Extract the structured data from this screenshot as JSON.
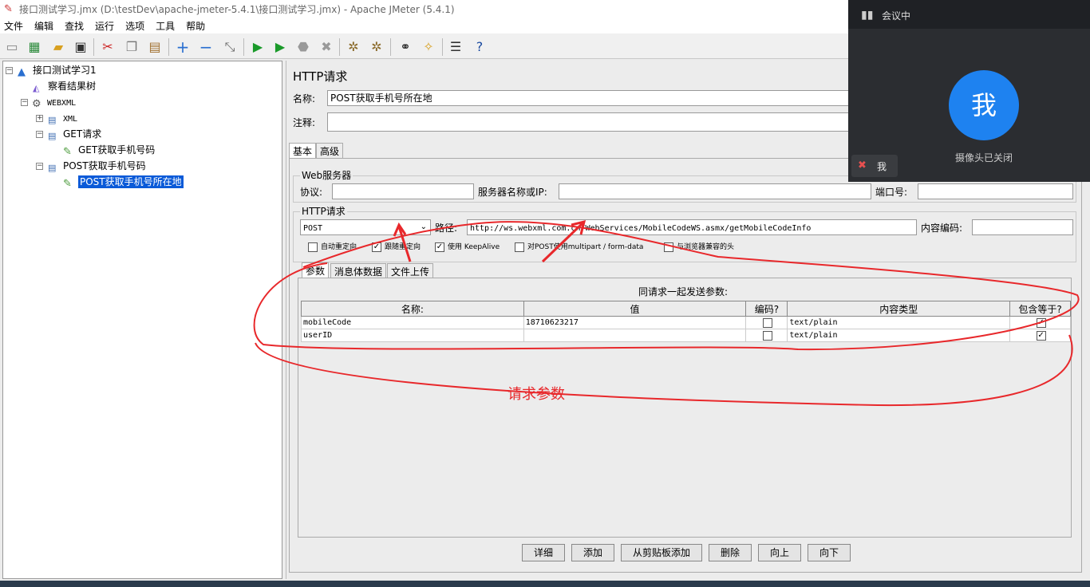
{
  "window": {
    "title": "接口测试学习.jmx (D:\\testDev\\apache-jmeter-5.4.1\\接口测试学习.jmx) - Apache JMeter (5.4.1)"
  },
  "menu": [
    "文件",
    "编辑",
    "查找",
    "运行",
    "选项",
    "工具",
    "帮助"
  ],
  "toolbar_icons": [
    "new-icon",
    "templates-icon",
    "open-icon",
    "save-icon",
    "cut-icon",
    "copy-icon",
    "paste-icon",
    "expand-icon",
    "collapse-icon",
    "toggle-icon",
    "start-icon",
    "start-no-pause-icon",
    "stop-icon",
    "shutdown-icon",
    "clear-icon",
    "clear-all-icon",
    "search-icon",
    "reset-search-icon",
    "function-helper-icon",
    "help-icon"
  ],
  "tree": {
    "root": "接口测试学习1",
    "items": [
      "察看结果树",
      "WEBXML",
      "XML",
      "GET请求",
      "GET获取手机号码",
      "POST获取手机号码",
      "POST获取手机号所在地"
    ]
  },
  "panel": {
    "title": "HTTP请求",
    "name_label": "名称:",
    "name_value": "POST获取手机号所在地",
    "comment_label": "注释:",
    "tabs": [
      "基本",
      "高级"
    ],
    "web_server": {
      "legend": "Web服务器",
      "protocol_label": "协议:",
      "server_label": "服务器名称或IP:",
      "port_label": "端口号:"
    },
    "http_request": {
      "legend": "HTTP请求",
      "method": "POST",
      "path_label": "路径:",
      "path_value": "http://ws.webxml.com.cn/WebServices/MobileCodeWS.asmx/getMobileCodeInfo",
      "encoding_label": "内容编码:"
    },
    "checkboxes": [
      {
        "label": "自动重定向",
        "checked": false
      },
      {
        "label": "跟随重定向",
        "checked": true
      },
      {
        "label": "使用 KeepAlive",
        "checked": true
      },
      {
        "label": "对POST使用multipart / form-data",
        "checked": false
      },
      {
        "label": "与浏览器兼容的头",
        "checked": false
      }
    ],
    "sub_tabs": [
      "参数",
      "消息体数据",
      "文件上传"
    ],
    "params_title": "同请求一起发送参数:",
    "columns": [
      "名称:",
      "值",
      "编码?",
      "内容类型",
      "包含等于?"
    ],
    "rows": [
      {
        "name": "mobileCode",
        "value": "18710623217",
        "encode": false,
        "content_type": "text/plain",
        "include_equals": true
      },
      {
        "name": "userID",
        "value": "",
        "encode": false,
        "content_type": "text/plain",
        "include_equals": true
      }
    ],
    "buttons": [
      "详细",
      "添加",
      "从剪贴板添加",
      "删除",
      "向上",
      "向下"
    ]
  },
  "annotation": {
    "text": "请求参数",
    "color": "#e8282b"
  },
  "meeting": {
    "status": "会议中",
    "avatar_text": "我",
    "camera_status": "摄像头已关闭",
    "self_label": "我",
    "accent": "#1e82f0"
  }
}
